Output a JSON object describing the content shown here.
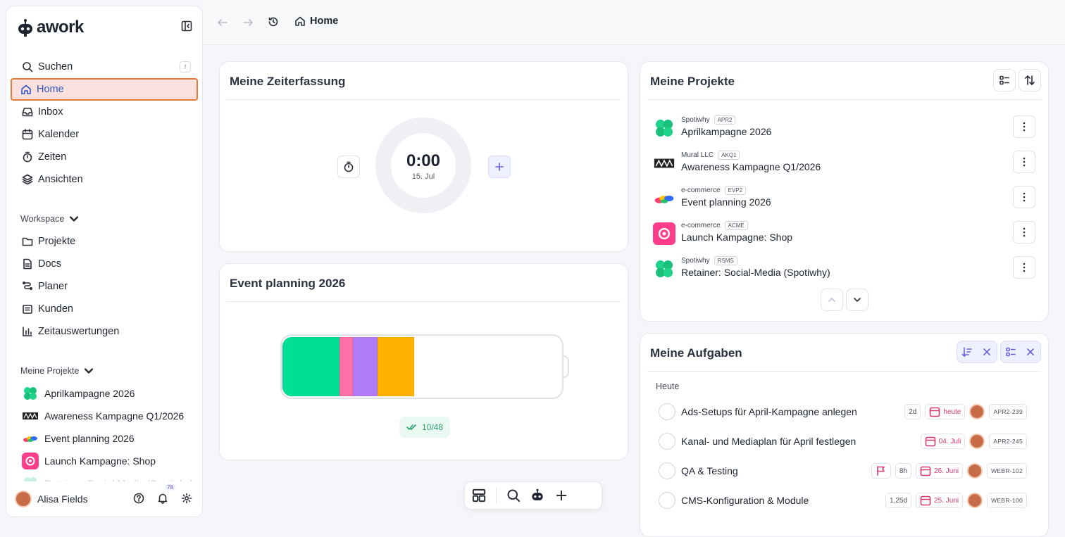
{
  "app": {
    "brand": "awork"
  },
  "sidebar": {
    "search": {
      "label": "Suchen",
      "shortcut": "f"
    },
    "nav": [
      {
        "label": "Home",
        "icon": "home-icon",
        "active": true
      },
      {
        "label": "Inbox",
        "icon": "inbox-icon"
      },
      {
        "label": "Kalender",
        "icon": "calendar-icon"
      },
      {
        "label": "Zeiten",
        "icon": "stopwatch-icon"
      },
      {
        "label": "Ansichten",
        "icon": "layers-icon"
      }
    ],
    "workspace_title": "Workspace",
    "workspace": [
      {
        "label": "Projekte",
        "icon": "folder-icon"
      },
      {
        "label": "Docs",
        "icon": "doc-icon"
      },
      {
        "label": "Planer",
        "icon": "planner-icon"
      },
      {
        "label": "Kunden",
        "icon": "building-icon"
      },
      {
        "label": "Zeitauswertungen",
        "icon": "chart-icon"
      }
    ],
    "my_projects_title": "Meine Projekte",
    "my_projects": [
      {
        "label": "Aprilkampagne 2026"
      },
      {
        "label": "Awareness Kampagne Q1/2026"
      },
      {
        "label": "Event planning 2026"
      },
      {
        "label": "Launch Kampagne: Shop"
      },
      {
        "label": "Retainer: Social-Media (Spotiwhy)"
      }
    ],
    "user": {
      "name": "Alisa Fields",
      "notifications": "78"
    }
  },
  "topbar": {
    "breadcrumb": "Home"
  },
  "time_tracking": {
    "title": "Meine Zeiterfassung",
    "time": "0:00",
    "date": "15. Jul"
  },
  "event": {
    "title": "Event planning 2026",
    "progress_label": "10/48",
    "segments_pct": [
      20.5,
      4.8,
      8.9,
      12.9
    ],
    "segment_colors": [
      "#00df95",
      "#ff6fa8",
      "#b07cf7",
      "#ffb200"
    ]
  },
  "projects": {
    "title": "Meine Projekte",
    "items": [
      {
        "client": "Spotiwhy",
        "key": "APR2",
        "name": "Aprilkampagne 2026"
      },
      {
        "client": "Mural LLC",
        "key": "AKQ1",
        "name": "Awareness Kampagne Q1/2026"
      },
      {
        "client": "e-commerce",
        "key": "EVP2",
        "name": "Event planning 2026"
      },
      {
        "client": "e-commerce",
        "key": "ACME",
        "name": "Launch Kampagne: Shop"
      },
      {
        "client": "Spotiwhy",
        "key": "RSMS",
        "name": "Retainer: Social-Media (Spotiwhy)"
      }
    ]
  },
  "tasks": {
    "title": "Meine Aufgaben",
    "group": "Heute",
    "items": [
      {
        "name": "Ads-Setups für April-Kampagne anlegen",
        "effort": "2d",
        "date": "heute",
        "key": "APR2-239"
      },
      {
        "name": "Kanal- und Mediaplan für April festlegen",
        "effort": "",
        "date": "04. Juli",
        "key": "APR2-245"
      },
      {
        "name": "QA & Testing",
        "effort": "8h",
        "date": "26. Juni",
        "key": "WEBR-102"
      },
      {
        "name": "CMS-Konfiguration & Module",
        "effort": "1,25d",
        "date": "25. Juni",
        "key": "WEBR-100"
      }
    ]
  }
}
